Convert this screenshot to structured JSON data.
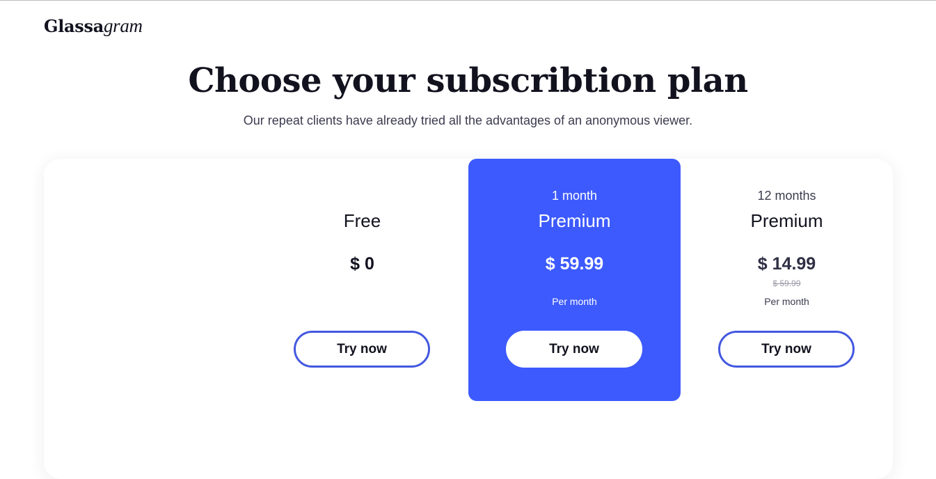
{
  "header": {
    "logo_bold": "Glassa",
    "logo_italic": "gram"
  },
  "hero": {
    "title": "Choose your subscribtion plan",
    "subtitle": "Our repeat clients have already tried all the advantages of an anonymous viewer."
  },
  "plans": [
    {
      "period": "",
      "name": "Free",
      "price": "$ 0",
      "old_price": "",
      "per": "",
      "button": "Try now",
      "highlighted": false
    },
    {
      "period": "1 month",
      "name": "Premium",
      "price": "$ 59.99",
      "old_price": "",
      "per": "Per month",
      "button": "Try now",
      "highlighted": true
    },
    {
      "period": "12 months",
      "name": "Premium",
      "price": "$ 14.99",
      "old_price": "$ 59.99",
      "per": "Per month",
      "button": "Try now",
      "highlighted": false
    }
  ],
  "colors": {
    "accent": "#3d5afe",
    "button_border": "#4358e0",
    "text": "#12121f",
    "muted": "#3b3b4f"
  }
}
